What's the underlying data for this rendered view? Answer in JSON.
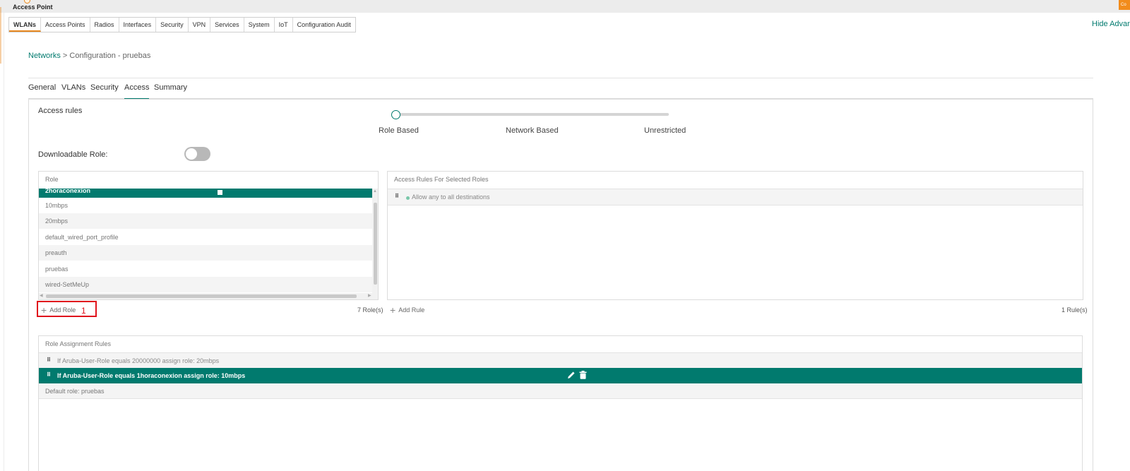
{
  "app": {
    "title": "Access Point",
    "corner_badge": "Co"
  },
  "main_tabs": [
    "WLANs",
    "Access Points",
    "Radios",
    "Interfaces",
    "Security",
    "VPN",
    "Services",
    "System",
    "IoT",
    "Configuration Audit"
  ],
  "hide_advanced": "Hide Advanced",
  "breadcrumb": {
    "link": "Networks",
    "separator": " > ",
    "current": "Configuration - pruebas"
  },
  "sub_tabs": [
    "General",
    "VLANs",
    "Security",
    "Access",
    "Summary"
  ],
  "access_rules": {
    "label": "Access rules",
    "options": [
      "Role Based",
      "Network Based",
      "Unrestricted"
    ]
  },
  "downloadable_role": {
    "label": "Downloadable Role:",
    "enabled": false
  },
  "role_panel": {
    "title": "Role",
    "roles": [
      "2horaconexion",
      "10mbps",
      "20mbps",
      "default_wired_port_profile",
      "preauth",
      "pruebas",
      "wired-SetMeUp"
    ],
    "add_label": "Add Role",
    "count": "7 Role(s)",
    "annotation": "1"
  },
  "rules_panel": {
    "title": "Access Rules For Selected Roles",
    "rules": [
      "Allow any to all destinations"
    ],
    "add_label": "Add Rule",
    "count": "1 Rule(s)"
  },
  "assignment_panel": {
    "title": "Role Assignment Rules",
    "rules": [
      "If Aruba-User-Role equals 20000000 assign role: 20mbps",
      "If Aruba-User-Role equals 1horaconexion assign role: 10mbps"
    ],
    "default_role": "Default role: pruebas"
  },
  "colors": {
    "accent": "#017a6e",
    "brand": "#e8871e",
    "annotation": "#e0121c"
  },
  "icons": [
    "grip-icon",
    "plus-icon",
    "pencil-icon",
    "trash-icon"
  ]
}
